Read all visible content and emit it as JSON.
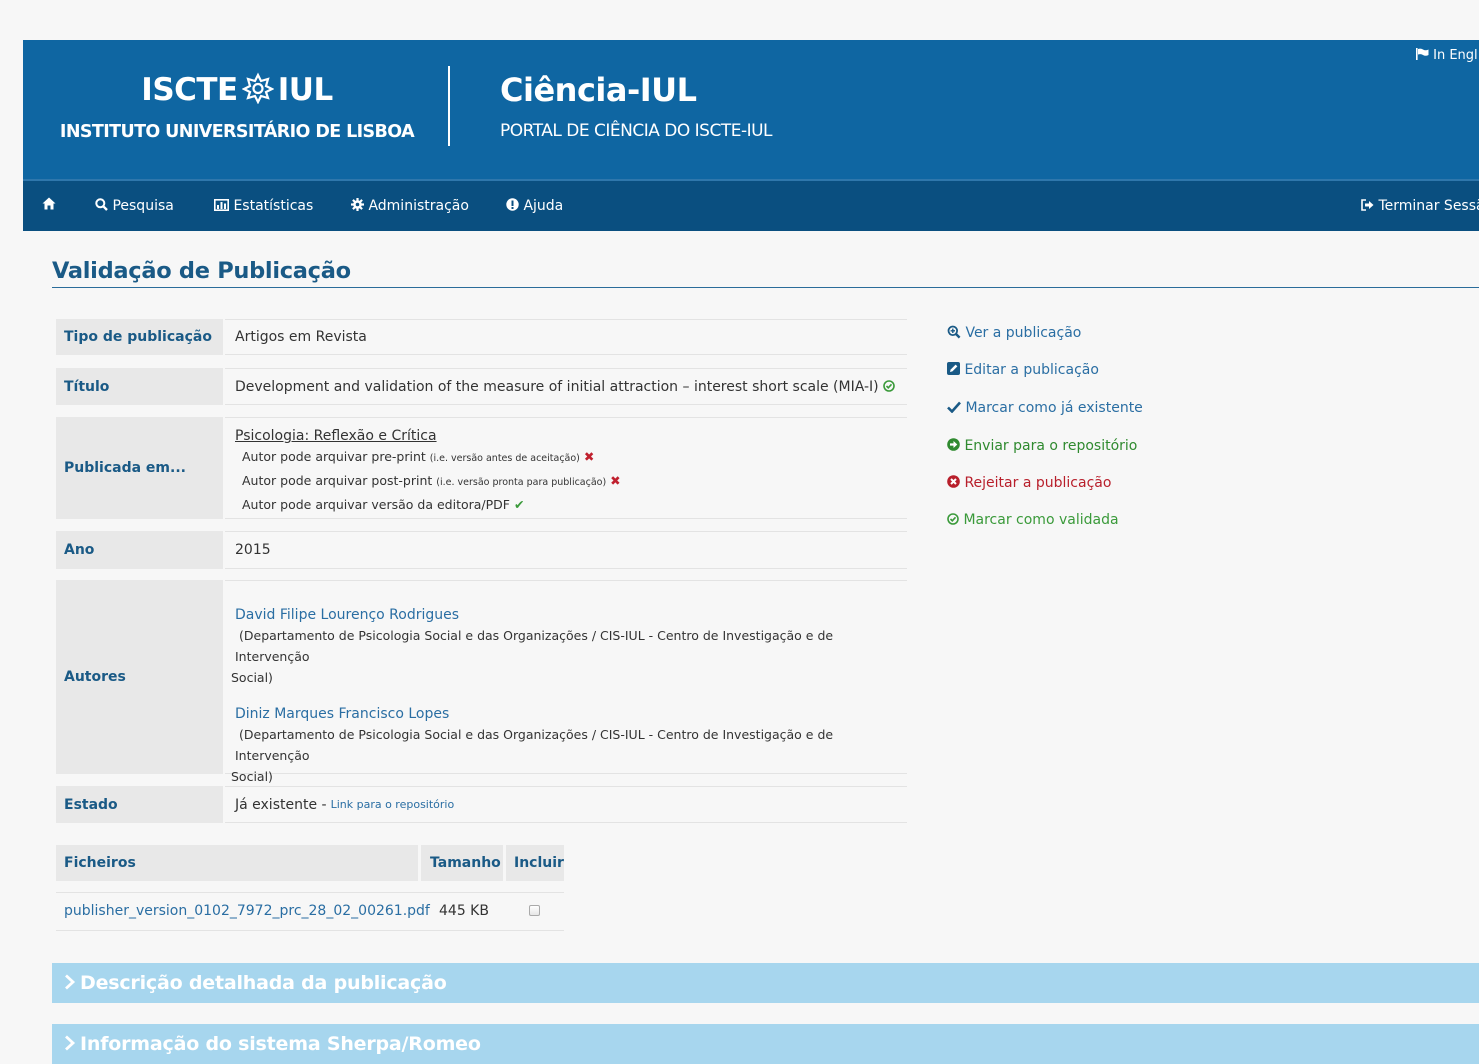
{
  "header": {
    "logo_left": "ISCTE",
    "logo_right": "IUL",
    "logo_subtitle": "INSTITUTO UNIVERSITÁRIO DE LISBOA",
    "portal_title": "Ciência-IUL",
    "portal_subtitle": "PORTAL DE CIÊNCIA DO ISCTE-IUL",
    "language_link": "In Engl"
  },
  "nav": {
    "items": [
      {
        "label": "Pesquisa",
        "icon": "search-icon"
      },
      {
        "label": "Estatísticas",
        "icon": "chart-icon"
      },
      {
        "label": "Administração",
        "icon": "gear-icon"
      },
      {
        "label": "Ajuda",
        "icon": "info-icon"
      }
    ],
    "logout": "Terminar Sessã"
  },
  "page_title": "Validação de Publicação",
  "details": {
    "type_label": "Tipo de publicação",
    "type_value": "Artigos em Revista",
    "title_label": "Título",
    "title_value": "Development and validation of the measure of initial attraction – interest short scale (MIA-I)",
    "published_label": "Publicada em...",
    "journal": "Psicologia: Reflexão e Crítica",
    "preprint_text": "Autor pode arquivar pre-print",
    "preprint_note": "(i.e. versão antes de aceitação)",
    "postprint_text": "Autor pode arquivar post-print",
    "postprint_note": "(i.e. versão pronta para publicação)",
    "publisher_text": "Autor pode arquivar versão da editora/PDF",
    "year_label": "Ano",
    "year_value": "2015",
    "authors_label": "Autores",
    "authors": [
      {
        "name": "David Filipe Lourenço Rodrigues",
        "affiliation_1": "(Departamento de Psicologia Social e das Organizações / CIS-IUL - Centro de Investigação e de Intervenção",
        "affiliation_2": "Social)"
      },
      {
        "name": "Diniz Marques Francisco Lopes",
        "affiliation_1": "(Departamento de Psicologia Social e das Organizações / CIS-IUL - Centro de Investigação e de Intervenção",
        "affiliation_2": "Social)"
      }
    ],
    "state_label": "Estado",
    "state_value": "Já existente -",
    "state_link": "Link para o repositório"
  },
  "actions": {
    "view": "Ver a publicação",
    "edit": "Editar a publicação",
    "mark_existing": "Marcar como já existente",
    "send_repo": "Enviar para o repositório",
    "reject": "Rejeitar a publicação",
    "mark_validated": "Marcar como validada"
  },
  "files": {
    "col_files": "Ficheiros",
    "col_size": "Tamanho",
    "col_include": "Incluir",
    "rows": [
      {
        "name": "publisher_version_0102_7972_prc_28_02_00261.pdf",
        "size": "445 KB",
        "include": false
      }
    ]
  },
  "sections": {
    "description": "Descrição detalhada da publicação",
    "sherpa": "Informação do sistema Sherpa/Romeo"
  },
  "colors": {
    "header_bg": "#0f66a2",
    "nav_bg": "#0a4f80",
    "title_blue": "#1a5a86",
    "link_blue": "#2a6ea3",
    "green": "#3a9a3a",
    "red": "#c0202e",
    "collapse_bg": "#a7d6ee"
  }
}
